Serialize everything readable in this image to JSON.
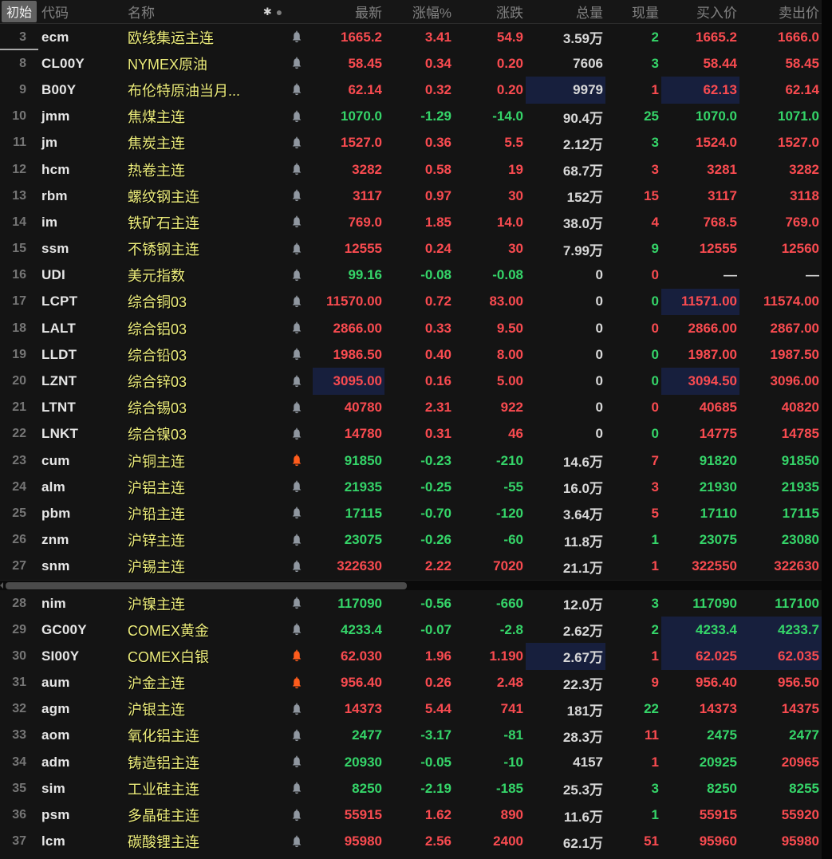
{
  "header": {
    "initial_label": "初始",
    "columns": {
      "code": "代码",
      "name": "名称",
      "latest": "最新",
      "pct": "涨幅%",
      "chg": "涨跌",
      "vol": "总量",
      "cur": "现量",
      "bid": "买入价",
      "ask": "卖出价"
    },
    "icon_asterisk": "✱",
    "icon_dot": "●"
  },
  "colors": {
    "up_red": "#f94b50",
    "down_green": "#35d569",
    "neutral_white": "#d8d8d8",
    "name_yellow": "#eded7c",
    "highlight_navy": "#171f3d",
    "bell_gray": "#9097a0",
    "bell_orange": "#ff5c1c"
  },
  "rows_top": [
    {
      "n": "3",
      "code": "ecm",
      "name": "欧线集运主连",
      "bell": "gray",
      "latest": [
        "1665.2",
        "R"
      ],
      "pct": [
        "3.41",
        "R"
      ],
      "chg": [
        "54.9",
        "R"
      ],
      "vol": [
        "3.59万",
        "W"
      ],
      "cur": [
        "2",
        "G"
      ],
      "bid": [
        "1665.2",
        "R"
      ],
      "ask": [
        "1666.0",
        "R"
      ],
      "divider_below": true
    },
    {
      "n": "8",
      "code": "CL00Y",
      "name": "NYMEX原油",
      "bell": "gray",
      "latest": [
        "58.45",
        "R"
      ],
      "pct": [
        "0.34",
        "R"
      ],
      "chg": [
        "0.20",
        "R"
      ],
      "vol": [
        "7606",
        "W"
      ],
      "cur": [
        "3",
        "G"
      ],
      "bid": [
        "58.44",
        "R"
      ],
      "ask": [
        "58.45",
        "R"
      ]
    },
    {
      "n": "9",
      "code": "B00Y",
      "name": "布伦特原油当月...",
      "bell": "gray",
      "latest": [
        "62.14",
        "R"
      ],
      "pct": [
        "0.32",
        "R"
      ],
      "chg": [
        "0.20",
        "R"
      ],
      "vol": [
        "9979",
        "W"
      ],
      "cur": [
        "1",
        "R"
      ],
      "bid": [
        "62.13",
        "R"
      ],
      "ask": [
        "62.14",
        "R"
      ],
      "hl": [
        "vol",
        "bid"
      ]
    },
    {
      "n": "10",
      "code": "jmm",
      "name": "焦煤主连",
      "bell": "gray",
      "latest": [
        "1070.0",
        "G"
      ],
      "pct": [
        "-1.29",
        "G"
      ],
      "chg": [
        "-14.0",
        "G"
      ],
      "vol": [
        "90.4万",
        "W"
      ],
      "cur": [
        "25",
        "G"
      ],
      "bid": [
        "1070.0",
        "G"
      ],
      "ask": [
        "1071.0",
        "G"
      ]
    },
    {
      "n": "11",
      "code": "jm",
      "name": "焦炭主连",
      "bell": "gray",
      "latest": [
        "1527.0",
        "R"
      ],
      "pct": [
        "0.36",
        "R"
      ],
      "chg": [
        "5.5",
        "R"
      ],
      "vol": [
        "2.12万",
        "W"
      ],
      "cur": [
        "3",
        "G"
      ],
      "bid": [
        "1524.0",
        "R"
      ],
      "ask": [
        "1527.0",
        "R"
      ]
    },
    {
      "n": "12",
      "code": "hcm",
      "name": "热卷主连",
      "bell": "gray",
      "latest": [
        "3282",
        "R"
      ],
      "pct": [
        "0.58",
        "R"
      ],
      "chg": [
        "19",
        "R"
      ],
      "vol": [
        "68.7万",
        "W"
      ],
      "cur": [
        "3",
        "R"
      ],
      "bid": [
        "3281",
        "R"
      ],
      "ask": [
        "3282",
        "R"
      ]
    },
    {
      "n": "13",
      "code": "rbm",
      "name": "螺纹钢主连",
      "bell": "gray",
      "latest": [
        "3117",
        "R"
      ],
      "pct": [
        "0.97",
        "R"
      ],
      "chg": [
        "30",
        "R"
      ],
      "vol": [
        "152万",
        "W"
      ],
      "cur": [
        "15",
        "R"
      ],
      "bid": [
        "3117",
        "R"
      ],
      "ask": [
        "3118",
        "R"
      ]
    },
    {
      "n": "14",
      "code": "im",
      "name": "铁矿石主连",
      "bell": "gray",
      "latest": [
        "769.0",
        "R"
      ],
      "pct": [
        "1.85",
        "R"
      ],
      "chg": [
        "14.0",
        "R"
      ],
      "vol": [
        "38.0万",
        "W"
      ],
      "cur": [
        "4",
        "R"
      ],
      "bid": [
        "768.5",
        "R"
      ],
      "ask": [
        "769.0",
        "R"
      ]
    },
    {
      "n": "15",
      "code": "ssm",
      "name": "不锈钢主连",
      "bell": "gray",
      "latest": [
        "12555",
        "R"
      ],
      "pct": [
        "0.24",
        "R"
      ],
      "chg": [
        "30",
        "R"
      ],
      "vol": [
        "7.99万",
        "W"
      ],
      "cur": [
        "9",
        "G"
      ],
      "bid": [
        "12555",
        "R"
      ],
      "ask": [
        "12560",
        "R"
      ]
    },
    {
      "n": "16",
      "code": "UDI",
      "name": "美元指数",
      "bell": "gray",
      "latest": [
        "99.16",
        "G"
      ],
      "pct": [
        "-0.08",
        "G"
      ],
      "chg": [
        "-0.08",
        "G"
      ],
      "vol": [
        "0",
        "W"
      ],
      "cur": [
        "0",
        "R"
      ],
      "bid": [
        "—",
        "W"
      ],
      "ask": [
        "—",
        "W"
      ]
    },
    {
      "n": "17",
      "code": "LCPT",
      "name": "综合铜03",
      "bell": "gray",
      "latest": [
        "11570.00",
        "R"
      ],
      "pct": [
        "0.72",
        "R"
      ],
      "chg": [
        "83.00",
        "R"
      ],
      "vol": [
        "0",
        "W"
      ],
      "cur": [
        "0",
        "G"
      ],
      "bid": [
        "11571.00",
        "R"
      ],
      "ask": [
        "11574.00",
        "R"
      ],
      "hl": [
        "bid"
      ]
    },
    {
      "n": "18",
      "code": "LALT",
      "name": "综合铝03",
      "bell": "gray",
      "latest": [
        "2866.00",
        "R"
      ],
      "pct": [
        "0.33",
        "R"
      ],
      "chg": [
        "9.50",
        "R"
      ],
      "vol": [
        "0",
        "W"
      ],
      "cur": [
        "0",
        "R"
      ],
      "bid": [
        "2866.00",
        "R"
      ],
      "ask": [
        "2867.00",
        "R"
      ]
    },
    {
      "n": "19",
      "code": "LLDT",
      "name": "综合铅03",
      "bell": "gray",
      "latest": [
        "1986.50",
        "R"
      ],
      "pct": [
        "0.40",
        "R"
      ],
      "chg": [
        "8.00",
        "R"
      ],
      "vol": [
        "0",
        "W"
      ],
      "cur": [
        "0",
        "G"
      ],
      "bid": [
        "1987.00",
        "R"
      ],
      "ask": [
        "1987.50",
        "R"
      ]
    },
    {
      "n": "20",
      "code": "LZNT",
      "name": "综合锌03",
      "bell": "gray",
      "latest": [
        "3095.00",
        "R"
      ],
      "pct": [
        "0.16",
        "R"
      ],
      "chg": [
        "5.00",
        "R"
      ],
      "vol": [
        "0",
        "W"
      ],
      "cur": [
        "0",
        "G"
      ],
      "bid": [
        "3094.50",
        "R"
      ],
      "ask": [
        "3096.00",
        "R"
      ],
      "hl": [
        "latest",
        "bid"
      ]
    },
    {
      "n": "21",
      "code": "LTNT",
      "name": "综合锡03",
      "bell": "gray",
      "latest": [
        "40780",
        "R"
      ],
      "pct": [
        "2.31",
        "R"
      ],
      "chg": [
        "922",
        "R"
      ],
      "vol": [
        "0",
        "W"
      ],
      "cur": [
        "0",
        "R"
      ],
      "bid": [
        "40685",
        "R"
      ],
      "ask": [
        "40820",
        "R"
      ]
    },
    {
      "n": "22",
      "code": "LNKT",
      "name": "综合镍03",
      "bell": "gray",
      "latest": [
        "14780",
        "R"
      ],
      "pct": [
        "0.31",
        "R"
      ],
      "chg": [
        "46",
        "R"
      ],
      "vol": [
        "0",
        "W"
      ],
      "cur": [
        "0",
        "G"
      ],
      "bid": [
        "14775",
        "R"
      ],
      "ask": [
        "14785",
        "R"
      ]
    },
    {
      "n": "23",
      "code": "cum",
      "name": "沪铜主连",
      "bell": "orange",
      "latest": [
        "91850",
        "G"
      ],
      "pct": [
        "-0.23",
        "G"
      ],
      "chg": [
        "-210",
        "G"
      ],
      "vol": [
        "14.6万",
        "W"
      ],
      "cur": [
        "7",
        "R"
      ],
      "bid": [
        "91820",
        "G"
      ],
      "ask": [
        "91850",
        "G"
      ]
    },
    {
      "n": "24",
      "code": "alm",
      "name": "沪铝主连",
      "bell": "gray",
      "latest": [
        "21935",
        "G"
      ],
      "pct": [
        "-0.25",
        "G"
      ],
      "chg": [
        "-55",
        "G"
      ],
      "vol": [
        "16.0万",
        "W"
      ],
      "cur": [
        "3",
        "R"
      ],
      "bid": [
        "21930",
        "G"
      ],
      "ask": [
        "21935",
        "G"
      ]
    },
    {
      "n": "25",
      "code": "pbm",
      "name": "沪铅主连",
      "bell": "gray",
      "latest": [
        "17115",
        "G"
      ],
      "pct": [
        "-0.70",
        "G"
      ],
      "chg": [
        "-120",
        "G"
      ],
      "vol": [
        "3.64万",
        "W"
      ],
      "cur": [
        "5",
        "R"
      ],
      "bid": [
        "17110",
        "G"
      ],
      "ask": [
        "17115",
        "G"
      ]
    },
    {
      "n": "26",
      "code": "znm",
      "name": "沪锌主连",
      "bell": "gray",
      "latest": [
        "23075",
        "G"
      ],
      "pct": [
        "-0.26",
        "G"
      ],
      "chg": [
        "-60",
        "G"
      ],
      "vol": [
        "11.8万",
        "W"
      ],
      "cur": [
        "1",
        "G"
      ],
      "bid": [
        "23075",
        "G"
      ],
      "ask": [
        "23080",
        "G"
      ]
    },
    {
      "n": "27",
      "code": "snm",
      "name": "沪锡主连",
      "bell": "gray",
      "latest": [
        "322630",
        "R"
      ],
      "pct": [
        "2.22",
        "R"
      ],
      "chg": [
        "7020",
        "R"
      ],
      "vol": [
        "21.1万",
        "W"
      ],
      "cur": [
        "1",
        "R"
      ],
      "bid": [
        "322550",
        "R"
      ],
      "ask": [
        "322630",
        "R"
      ]
    }
  ],
  "rows_bottom": [
    {
      "n": "28",
      "code": "nim",
      "name": "沪镍主连",
      "bell": "gray",
      "latest": [
        "117090",
        "G"
      ],
      "pct": [
        "-0.56",
        "G"
      ],
      "chg": [
        "-660",
        "G"
      ],
      "vol": [
        "12.0万",
        "W"
      ],
      "cur": [
        "3",
        "G"
      ],
      "bid": [
        "117090",
        "G"
      ],
      "ask": [
        "117100",
        "G"
      ]
    },
    {
      "n": "29",
      "code": "GC00Y",
      "name": "COMEX黄金",
      "bell": "gray",
      "latest": [
        "4233.4",
        "G"
      ],
      "pct": [
        "-0.07",
        "G"
      ],
      "chg": [
        "-2.8",
        "G"
      ],
      "vol": [
        "2.62万",
        "W"
      ],
      "cur": [
        "2",
        "G"
      ],
      "bid": [
        "4233.4",
        "G"
      ],
      "ask": [
        "4233.7",
        "G"
      ],
      "hl": [
        "bid",
        "ask"
      ]
    },
    {
      "n": "30",
      "code": "SI00Y",
      "name": "COMEX白银",
      "bell": "orange",
      "latest": [
        "62.030",
        "R"
      ],
      "pct": [
        "1.96",
        "R"
      ],
      "chg": [
        "1.190",
        "R"
      ],
      "vol": [
        "2.67万",
        "W"
      ],
      "cur": [
        "1",
        "R"
      ],
      "bid": [
        "62.025",
        "R"
      ],
      "ask": [
        "62.035",
        "R"
      ],
      "hl": [
        "vol",
        "bid",
        "ask"
      ]
    },
    {
      "n": "31",
      "code": "aum",
      "name": "沪金主连",
      "bell": "orange",
      "latest": [
        "956.40",
        "R"
      ],
      "pct": [
        "0.26",
        "R"
      ],
      "chg": [
        "2.48",
        "R"
      ],
      "vol": [
        "22.3万",
        "W"
      ],
      "cur": [
        "9",
        "R"
      ],
      "bid": [
        "956.40",
        "R"
      ],
      "ask": [
        "956.50",
        "R"
      ]
    },
    {
      "n": "32",
      "code": "agm",
      "name": "沪银主连",
      "bell": "gray",
      "latest": [
        "14373",
        "R"
      ],
      "pct": [
        "5.44",
        "R"
      ],
      "chg": [
        "741",
        "R"
      ],
      "vol": [
        "181万",
        "W"
      ],
      "cur": [
        "22",
        "G"
      ],
      "bid": [
        "14373",
        "R"
      ],
      "ask": [
        "14375",
        "R"
      ]
    },
    {
      "n": "33",
      "code": "aom",
      "name": "氧化铝主连",
      "bell": "gray",
      "latest": [
        "2477",
        "G"
      ],
      "pct": [
        "-3.17",
        "G"
      ],
      "chg": [
        "-81",
        "G"
      ],
      "vol": [
        "28.3万",
        "W"
      ],
      "cur": [
        "11",
        "R"
      ],
      "bid": [
        "2475",
        "G"
      ],
      "ask": [
        "2477",
        "G"
      ]
    },
    {
      "n": "34",
      "code": "adm",
      "name": "铸造铝主连",
      "bell": "gray",
      "latest": [
        "20930",
        "G"
      ],
      "pct": [
        "-0.05",
        "G"
      ],
      "chg": [
        "-10",
        "G"
      ],
      "vol": [
        "4157",
        "W"
      ],
      "cur": [
        "1",
        "R"
      ],
      "bid": [
        "20925",
        "G"
      ],
      "ask": [
        "20965",
        "R"
      ]
    },
    {
      "n": "35",
      "code": "sim",
      "name": "工业硅主连",
      "bell": "gray",
      "latest": [
        "8250",
        "G"
      ],
      "pct": [
        "-2.19",
        "G"
      ],
      "chg": [
        "-185",
        "G"
      ],
      "vol": [
        "25.3万",
        "W"
      ],
      "cur": [
        "3",
        "G"
      ],
      "bid": [
        "8250",
        "G"
      ],
      "ask": [
        "8255",
        "G"
      ]
    },
    {
      "n": "36",
      "code": "psm",
      "name": "多晶硅主连",
      "bell": "gray",
      "latest": [
        "55915",
        "R"
      ],
      "pct": [
        "1.62",
        "R"
      ],
      "chg": [
        "890",
        "R"
      ],
      "vol": [
        "11.6万",
        "W"
      ],
      "cur": [
        "1",
        "G"
      ],
      "bid": [
        "55915",
        "R"
      ],
      "ask": [
        "55920",
        "R"
      ]
    },
    {
      "n": "37",
      "code": "lcm",
      "name": "碳酸锂主连",
      "bell": "gray",
      "latest": [
        "95980",
        "R"
      ],
      "pct": [
        "2.56",
        "R"
      ],
      "chg": [
        "2400",
        "R"
      ],
      "vol": [
        "62.1万",
        "W"
      ],
      "cur": [
        "51",
        "R"
      ],
      "bid": [
        "95960",
        "R"
      ],
      "ask": [
        "95980",
        "R"
      ]
    }
  ]
}
